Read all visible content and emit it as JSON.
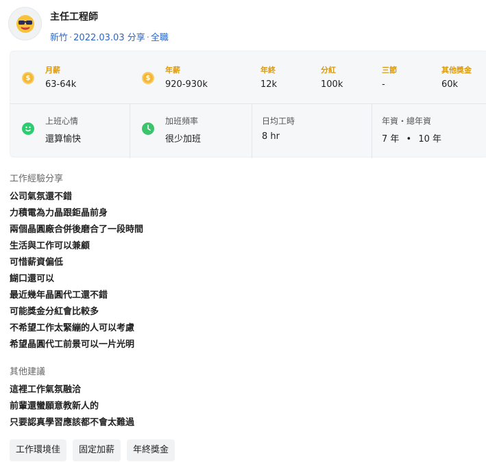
{
  "header": {
    "title": "主任工程師",
    "location": "新竹",
    "date": "2022.03.03",
    "shared": "分享",
    "employment": "全職",
    "avatar_icon": "sunglasses-face-icon"
  },
  "salary": [
    {
      "label": "月薪",
      "value": "63-64k",
      "icon": "coin-icon"
    },
    {
      "label": "年薪",
      "value": "920-930k",
      "icon": "coin-icon"
    },
    {
      "label": "年終",
      "value": "12k"
    },
    {
      "label": "分紅",
      "value": "100k"
    },
    {
      "label": "三節",
      "value": "-"
    },
    {
      "label": "其他獎金",
      "value": "60k"
    }
  ],
  "work": {
    "mood_label": "上班心情",
    "mood_value": "還算愉快",
    "overtime_label": "加班頻率",
    "overtime_value": "很少加班",
    "hours_label": "日均工時",
    "hours_value": "8 hr",
    "seniority_label": "年資・總年資",
    "seniority_years": "7 年",
    "seniority_sep": "•",
    "seniority_total": "10 年"
  },
  "experience": {
    "title": "工作經驗分享",
    "lines": [
      "公司氣氛還不錯",
      "力積電為力晶跟鉅晶前身",
      "兩個晶圓廠合併後磨合了一段時間",
      "生活與工作可以兼顧",
      "可惜薪資偏低",
      "餬口還可以",
      "最近幾年晶圓代工還不錯",
      "可能獎金分紅會比較多",
      "不希望工作太緊繃的人可以考慮",
      "希望晶圓代工前景可以一片光明"
    ]
  },
  "advice": {
    "title": "其他建議",
    "lines": [
      "這裡工作氣氛融洽",
      "前輩還蠻願意教新人的",
      "只要認真學習應該都不會太難過"
    ]
  },
  "tags": [
    "工作環境佳",
    "固定加薪",
    "年終獎金"
  ]
}
